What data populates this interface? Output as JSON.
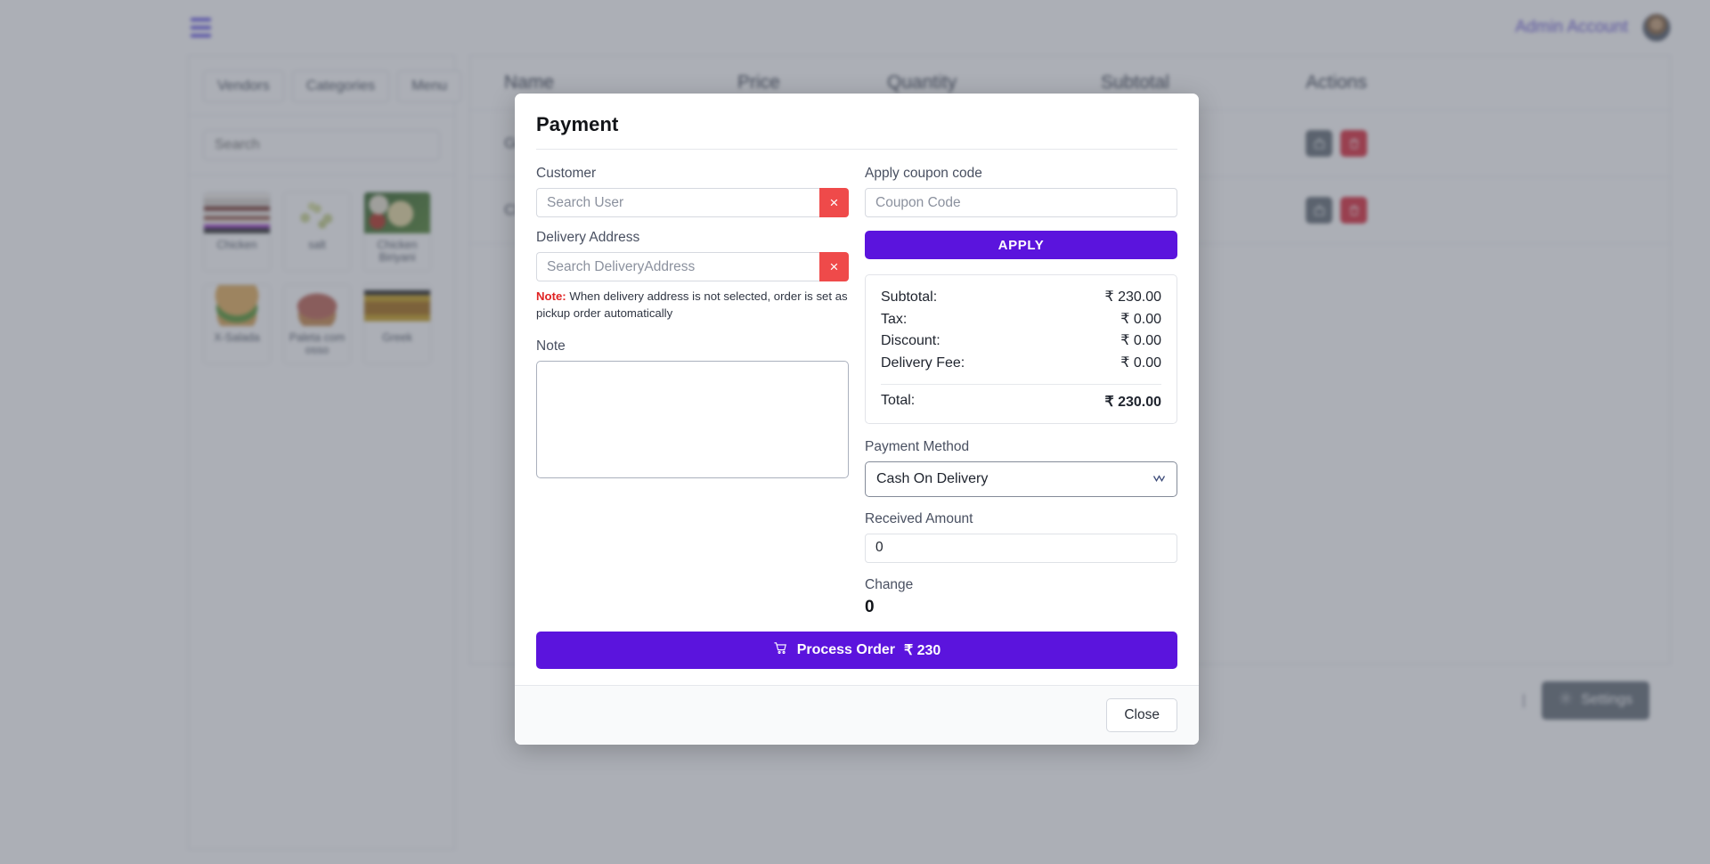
{
  "topbar": {
    "menu_icon": "hamburger-icon",
    "admin_name": "Admin Account",
    "avatar_icon": "avatar"
  },
  "left_panel": {
    "tabs": [
      {
        "label": "Vendors"
      },
      {
        "label": "Categories"
      },
      {
        "label": "Menu"
      }
    ],
    "search_placeholder": "Search",
    "search_value": "",
    "items": [
      {
        "label": "Chicken",
        "thumb_class": "fc-chicken"
      },
      {
        "label": "salt",
        "thumb_class": "fc-salt"
      },
      {
        "label": "Chicken Biriyani",
        "thumb_class": "fc-biriyani"
      },
      {
        "label": "X-Salada",
        "thumb_class": "fc-xsalada"
      },
      {
        "label": "Paleta com osso",
        "thumb_class": "fc-paleta"
      },
      {
        "label": "Greek",
        "thumb_class": "fc-greek"
      }
    ]
  },
  "cart_table": {
    "columns": [
      "Name",
      "Price",
      "Quantity",
      "Subtotal",
      "Actions"
    ],
    "rows": [
      {
        "name": "Greek",
        "price": "",
        "quantity": "",
        "subtotal": ""
      },
      {
        "name": "Chicken",
        "price": "",
        "quantity": "",
        "subtotal": ""
      }
    ],
    "row_actions": [
      {
        "icon": "bag-icon"
      },
      {
        "icon": "trash-icon"
      }
    ]
  },
  "bg_footer": {
    "separator": "|",
    "settings_label": "Settings",
    "settings_icon": "gear-icon"
  },
  "modal": {
    "title": "Payment",
    "customer": {
      "label": "Customer",
      "placeholder": "Search User",
      "value": "",
      "clear_label": "×",
      "clear_icon": "close-icon"
    },
    "delivery_address": {
      "label": "Delivery Address",
      "placeholder": "Search DeliveryAddress",
      "value": "",
      "clear_label": "×",
      "clear_icon": "close-icon"
    },
    "note_warning": {
      "prefix": "Note:",
      "text": "When delivery address is not selected, order is set as pickup order automatically"
    },
    "note": {
      "label": "Note",
      "value": "",
      "placeholder": ""
    },
    "coupon": {
      "label": "Apply coupon code",
      "placeholder": "Coupon Code",
      "value": "",
      "apply_label": "APPLY"
    },
    "summary": {
      "rows": [
        {
          "label": "Subtotal:",
          "value": "₹ 230.00"
        },
        {
          "label": "Tax:",
          "value": "₹ 0.00"
        },
        {
          "label": "Discount:",
          "value": "₹ 0.00"
        },
        {
          "label": "Delivery Fee:",
          "value": "₹ 0.00"
        }
      ],
      "total_label": "Total:",
      "total_value": "₹ 230.00"
    },
    "payment_method": {
      "label": "Payment Method",
      "selected": "Cash On Delivery",
      "options": [
        "Cash On Delivery"
      ],
      "caret_icon": "chevron-down-icon"
    },
    "received_amount": {
      "label": "Received Amount",
      "value": "0"
    },
    "change": {
      "label": "Change",
      "value": "0"
    },
    "process_order": {
      "label": "Process Order",
      "amount": "₹ 230",
      "icon": "cart-icon"
    },
    "close_label": "Close"
  },
  "colors": {
    "primary": "#5b14dd",
    "danger": "#ef4a4a",
    "warning_text": "#e02424",
    "muted": "#6c757d"
  }
}
